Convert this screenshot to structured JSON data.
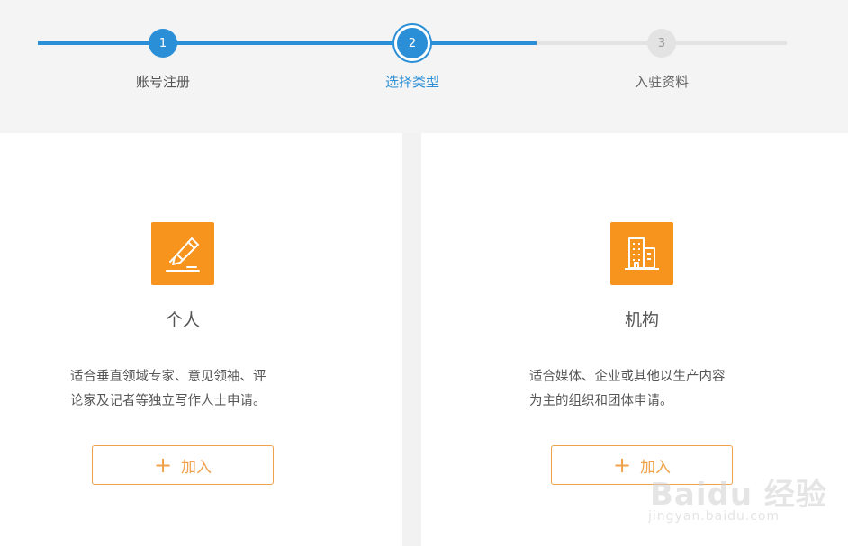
{
  "stepper": {
    "steps": [
      {
        "number": "1",
        "label": "账号注册"
      },
      {
        "number": "2",
        "label": "选择类型"
      },
      {
        "number": "3",
        "label": "入驻资料"
      }
    ]
  },
  "cards": [
    {
      "title": "个人",
      "description_line1": "适合垂直领域专家、意见领袖、评",
      "description_line2": "论家及记者等独立写作人士申请。",
      "button_plus": "+",
      "button_label": "加入"
    },
    {
      "title": "机构",
      "description_line1": "适合媒体、企业或其他以生产内容",
      "description_line2": "为主的组织和团体申请。",
      "button_plus": "+",
      "button_label": "加入"
    }
  ],
  "watermark": {
    "main": "Baidu 经验",
    "sub": "jingyan.baidu.com"
  },
  "colors": {
    "accent_blue": "#2a8fd6",
    "accent_orange": "#f7941d",
    "button_border": "#f0a24a"
  },
  "icons": {
    "personal": "pen-writing-icon",
    "organization": "building-icon"
  }
}
